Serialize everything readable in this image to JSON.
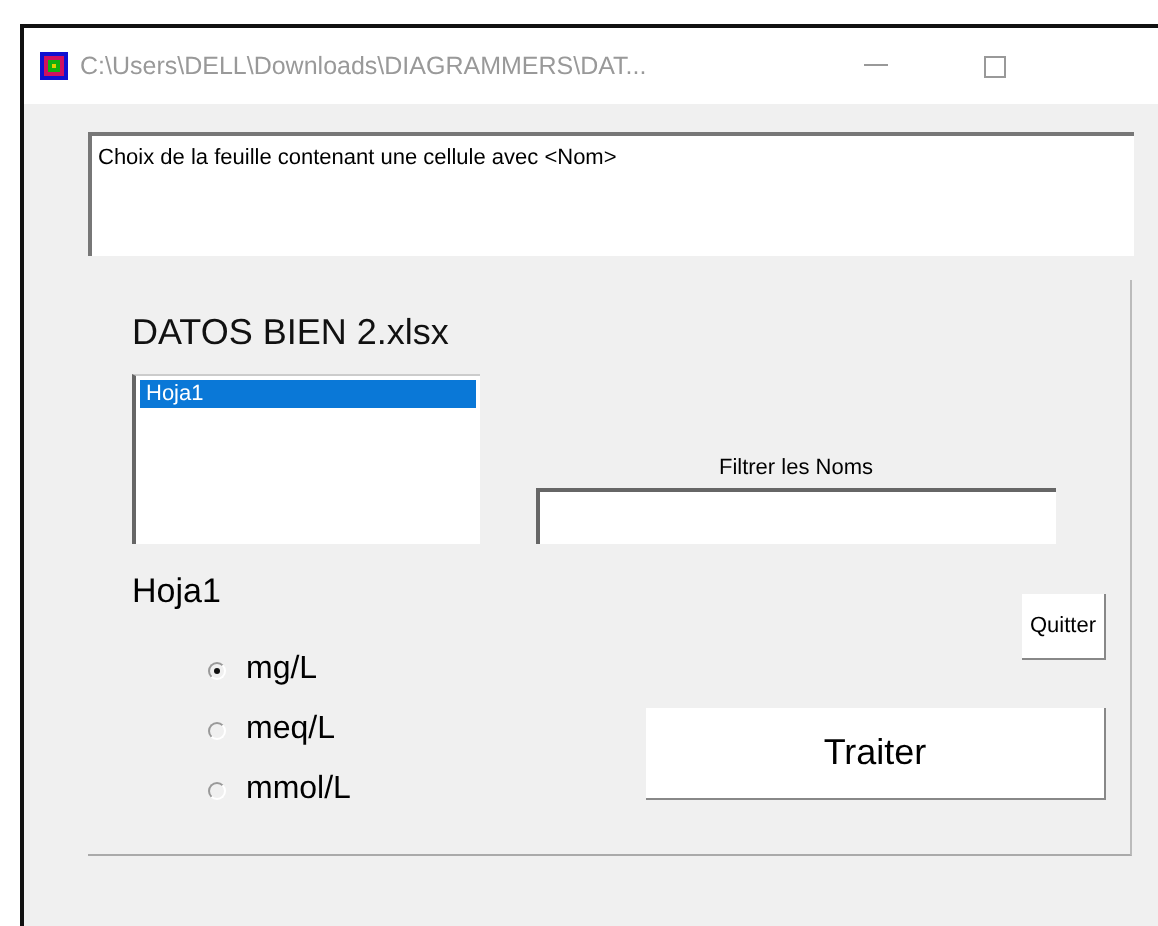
{
  "window": {
    "title": "C:\\Users\\DELL\\Downloads\\DIAGRAMMERS\\DAT..."
  },
  "message": "Choix de la feuille contenant une cellule avec <Nom>",
  "file_name": "DATOS BIEN 2.xlsx",
  "sheets": [
    {
      "label": "Hoja1",
      "selected": true
    }
  ],
  "filter": {
    "label": "Filtrer les Noms"
  },
  "sheet_label": "Hoja1",
  "units": [
    {
      "label": "mg/L",
      "selected": true
    },
    {
      "label": "meq/L",
      "selected": false
    },
    {
      "label": "mmol/L",
      "selected": false
    }
  ],
  "buttons": {
    "quit": "Quitter",
    "process": "Traiter"
  }
}
